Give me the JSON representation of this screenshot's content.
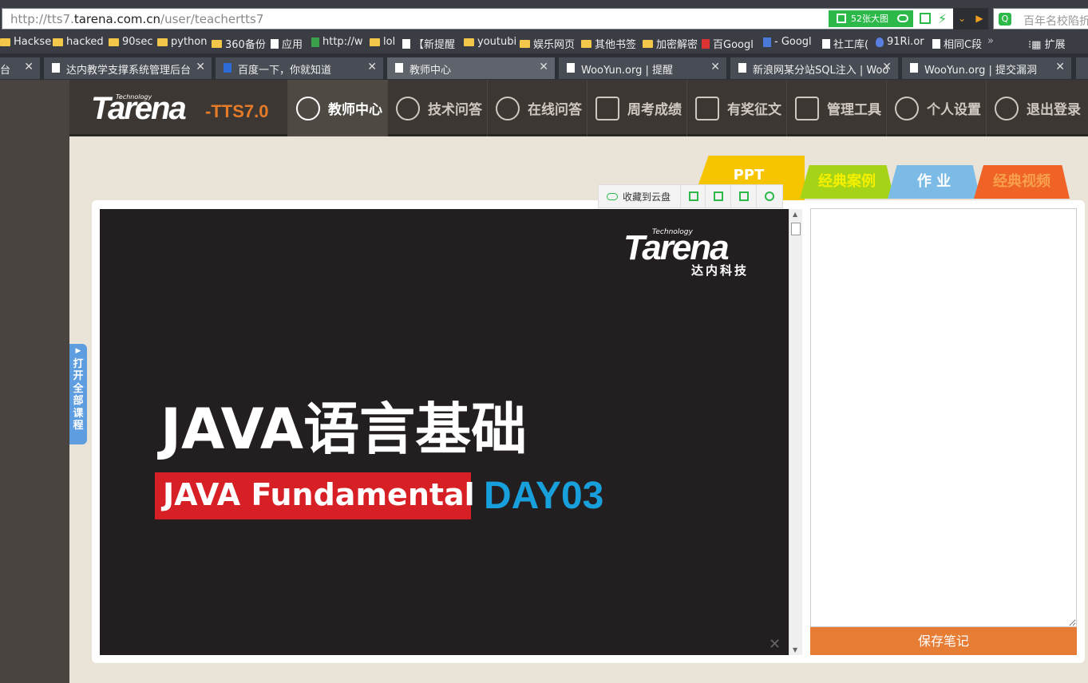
{
  "browser": {
    "url_prefix": "http://tts7.",
    "url_domain": "tarena.com.cn",
    "url_path": "/user/teachertts7",
    "image_count": "52张大图",
    "search_placeholder": "百年名校陷折"
  },
  "bookmarks": [
    {
      "label": "Hackse",
      "icon": "folder"
    },
    {
      "label": "hacked",
      "icon": "folder"
    },
    {
      "label": "90sec",
      "icon": "folder"
    },
    {
      "label": "python",
      "icon": "folder"
    },
    {
      "label": "360备份",
      "icon": "folder"
    },
    {
      "label": "应用",
      "icon": "page"
    },
    {
      "label": "http://w",
      "icon": "page"
    },
    {
      "label": "lol",
      "icon": "folder"
    },
    {
      "label": "【新提醒",
      "icon": "page"
    },
    {
      "label": "youtubi",
      "icon": "folder"
    },
    {
      "label": "娱乐网页",
      "icon": "folder"
    },
    {
      "label": "其他书签",
      "icon": "folder"
    },
    {
      "label": "加密解密",
      "icon": "folder"
    },
    {
      "label": "百Googl",
      "icon": "page"
    },
    {
      "label": "- Googl",
      "icon": "page"
    },
    {
      "label": "社工库(",
      "icon": "page"
    },
    {
      "label": "91Ri.or",
      "icon": "page"
    },
    {
      "label": "相同C段",
      "icon": "page"
    }
  ],
  "bookmarks_more": "»",
  "extensions_label": "扩展",
  "tabs": [
    {
      "title": "台"
    },
    {
      "title": "达内教学支撑系统管理后台"
    },
    {
      "title": "百度一下，你就知道"
    },
    {
      "title": "教师中心"
    },
    {
      "title": "WooYun.org | 提醒"
    },
    {
      "title": "新浪网某分站SQL注入 | Woo"
    },
    {
      "title": "WooYun.org | 提交漏洞"
    }
  ],
  "site": {
    "logo": "Tarena",
    "logo_sub": "Technology",
    "version": "-TTS7.0",
    "nav": [
      {
        "label": "教师中心",
        "icon": "user-icon"
      },
      {
        "label": "技术问答",
        "icon": "face-icon"
      },
      {
        "label": "在线问答",
        "icon": "face-icon"
      },
      {
        "label": "周考成绩",
        "icon": "pen-icon"
      },
      {
        "label": "有奖征文",
        "icon": "graduation-cap-icon"
      },
      {
        "label": "管理工具",
        "icon": "wrench-icon"
      },
      {
        "label": "个人设置",
        "icon": "gear-icon"
      },
      {
        "label": "退出登录",
        "icon": "power-icon"
      }
    ],
    "content_tabs": {
      "ppt": "PPT",
      "case": "经典案例",
      "work": "作 业",
      "video": "经典视频"
    },
    "toolbar": {
      "save_cloud": "收藏到云盘"
    },
    "slide": {
      "logo": "Tarena",
      "logo_sub": "Technology",
      "logo_cn": "达内科技",
      "title": "JAVA语言基础",
      "subtitle": "JAVA Fundamental",
      "day": "DAY03"
    },
    "save_notes": "保存笔记",
    "open_courses": [
      "打",
      "开",
      "全",
      "部",
      "课",
      "程"
    ]
  }
}
